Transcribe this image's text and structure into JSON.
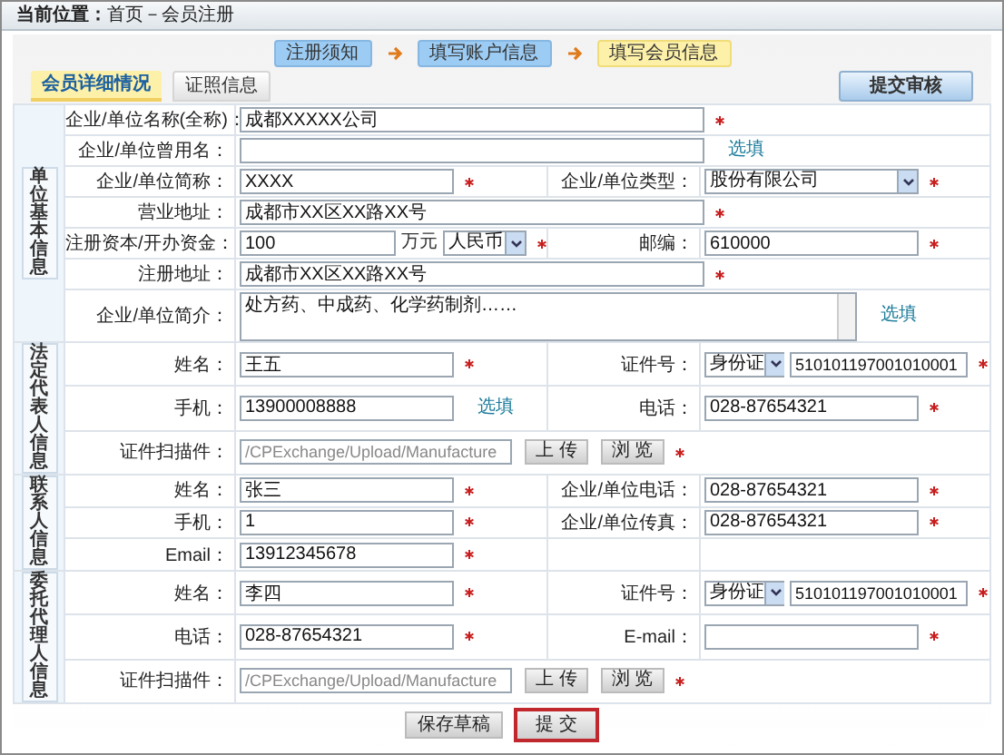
{
  "breadcrumb": {
    "label": "当前位置：",
    "path": "首页－会员注册"
  },
  "steps": [
    {
      "label": "注册须知",
      "current": false
    },
    {
      "label": "填写账户信息",
      "current": false
    },
    {
      "label": "填写会员信息",
      "current": true
    }
  ],
  "tabs": [
    {
      "label": "会员详细情况",
      "selected": true
    },
    {
      "label": "证照信息",
      "selected": false
    }
  ],
  "submit_review_button": "提交审核",
  "sections": [
    {
      "title": "单位基本信息",
      "rows": [
        {
          "kind": "wide",
          "fields": [
            {
              "label": "企业/单位名称(全称)：",
              "kind": "text",
              "value": "成都XXXXX公司",
              "required": true
            }
          ]
        },
        {
          "kind": "wide",
          "fields": [
            {
              "label": "企业/单位曾用名：",
              "kind": "text",
              "required": false,
              "note": "选填"
            }
          ]
        },
        {
          "kind": "pair",
          "fields": [
            {
              "label": "企业/单位简称：",
              "kind": "text",
              "value": "XXXX",
              "required": true
            },
            {
              "label": "企业/单位类型：",
              "kind": "select",
              "value": "股份有限公司",
              "required": true
            }
          ]
        },
        {
          "kind": "wide",
          "fields": [
            {
              "label": "营业地址：",
              "kind": "text",
              "value": "成都市XX区XX路XX号",
              "required": true
            }
          ]
        },
        {
          "kind": "pair",
          "fields": [
            {
              "label": "注册资本/开办资金：",
              "kind": "capital",
              "value": "100",
              "unit": "万元",
              "currency": "人民币",
              "required": true
            },
            {
              "label": "邮编：",
              "kind": "text",
              "value": "610000",
              "required": true
            }
          ]
        },
        {
          "kind": "wide",
          "fields": [
            {
              "label": "注册地址：",
              "kind": "text",
              "value": "成都市XX区XX路XX号",
              "required": true
            }
          ]
        },
        {
          "kind": "wide",
          "fields": [
            {
              "label": "企业/单位简介：",
              "kind": "textarea",
              "value": "处方药、中成药、化学药制剂……",
              "required": false,
              "note": "选填"
            }
          ]
        }
      ]
    },
    {
      "title": "法定代表人信息",
      "rows": [
        {
          "kind": "pair",
          "fields": [
            {
              "label": "姓名：",
              "kind": "text",
              "value": "王五",
              "required": true
            },
            {
              "label": "证件号：",
              "kind": "id",
              "id_type": "身份证",
              "value": "510101197001010001",
              "required": true
            }
          ]
        },
        {
          "kind": "pair",
          "fields": [
            {
              "label": "手机：",
              "kind": "text",
              "value": "13900008888",
              "required": false,
              "note": "选填"
            },
            {
              "label": "电话：",
              "kind": "text",
              "value": "028-87654321",
              "required": true
            }
          ]
        },
        {
          "kind": "wide",
          "fields": [
            {
              "label": "证件扫描件：",
              "kind": "upload",
              "value": "/CPExchange/Upload/Manufacture",
              "buttons": [
                "上 传",
                "浏 览"
              ],
              "required": true
            }
          ]
        }
      ]
    },
    {
      "title": "联系人信息",
      "rows": [
        {
          "kind": "pair",
          "fields": [
            {
              "label": "姓名：",
              "kind": "text",
              "value": "张三",
              "required": true
            },
            {
              "label": "企业/单位电话：",
              "kind": "text",
              "value": "028-87654321",
              "required": true
            }
          ]
        },
        {
          "kind": "pair",
          "fields": [
            {
              "label": "手机：",
              "kind": "text",
              "value": "1",
              "required": true
            },
            {
              "label": "企业/单位传真：",
              "kind": "text",
              "value": "028-87654321",
              "required": true
            }
          ]
        },
        {
          "kind": "pair",
          "fields": [
            {
              "label": "Email：",
              "kind": "text",
              "value": "13912345678",
              "required": true
            }
          ]
        }
      ]
    },
    {
      "title": "委托代理人信息",
      "rows": [
        {
          "kind": "pair",
          "fields": [
            {
              "label": "姓名：",
              "kind": "text",
              "value": "李四",
              "required": true
            },
            {
              "label": "证件号：",
              "kind": "id",
              "id_type": "身份证",
              "value": "510101197001010001",
              "required": true
            }
          ]
        },
        {
          "kind": "pair",
          "fields": [
            {
              "label": "电话：",
              "kind": "text",
              "value": "028-87654321",
              "required": true
            },
            {
              "label": "E-mail：",
              "kind": "text",
              "required": true
            }
          ]
        },
        {
          "kind": "wide",
          "fields": [
            {
              "label": "证件扫描件：",
              "kind": "upload",
              "value": "/CPExchange/Upload/Manufacture",
              "buttons": [
                "上 传",
                "浏 览"
              ],
              "required": true
            }
          ]
        }
      ]
    }
  ],
  "buttons": [
    {
      "label": "保存草稿",
      "highlighted": false
    },
    {
      "label": "提 交",
      "highlighted": true
    }
  ]
}
